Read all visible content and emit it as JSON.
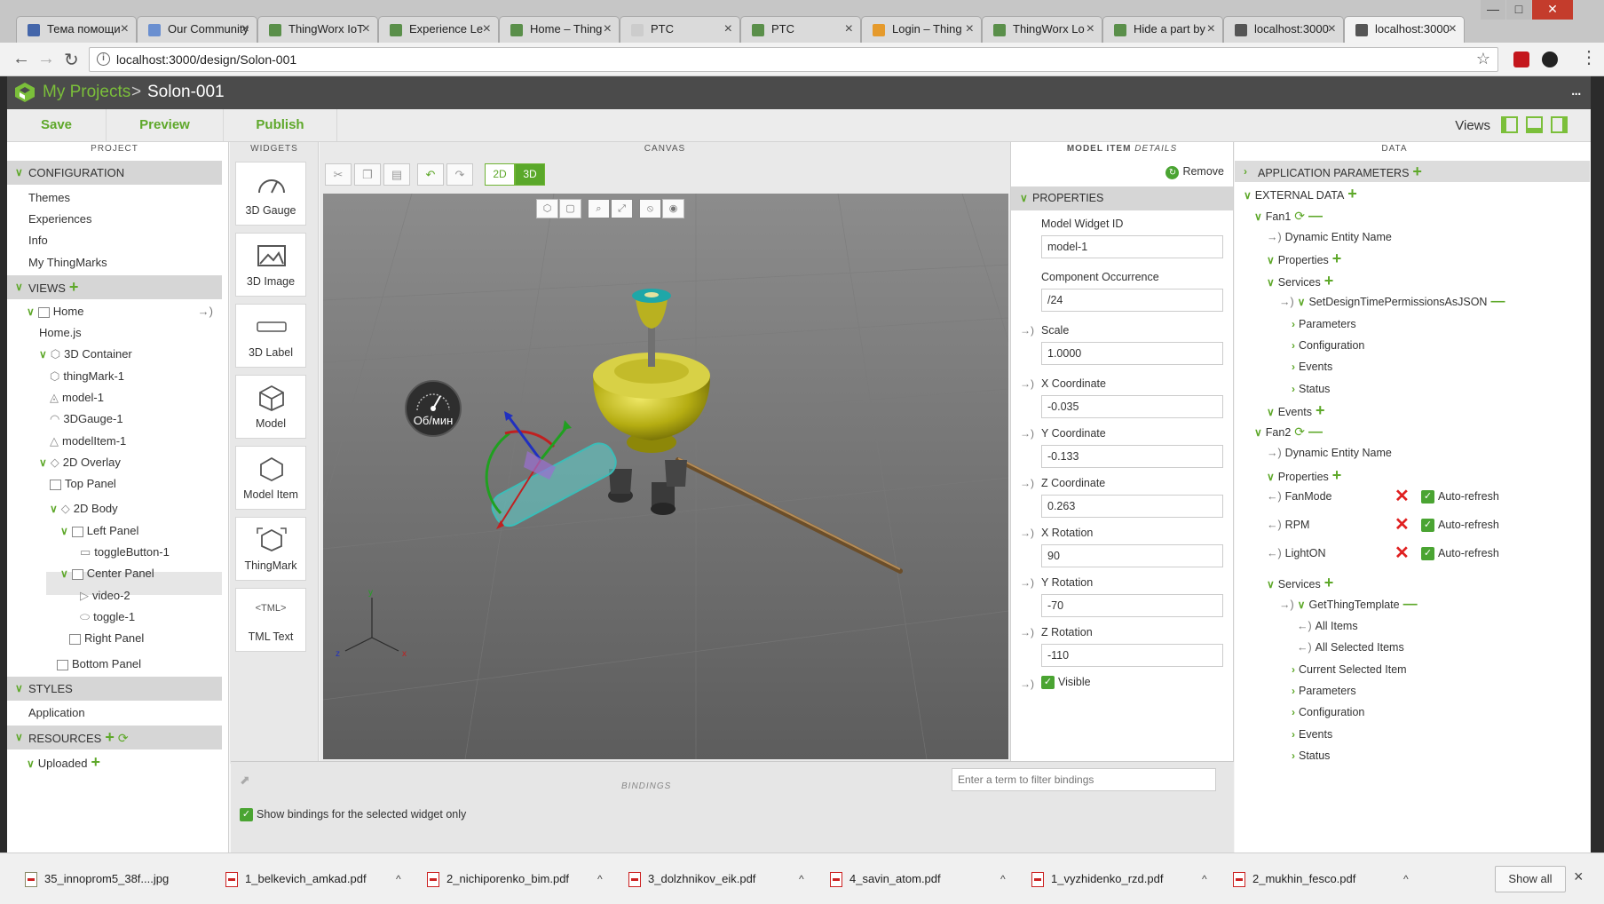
{
  "browser": {
    "tabs": [
      {
        "label": "Тема помощи",
        "fav_color": "#4466aa"
      },
      {
        "label": "Our Community",
        "fav_color": "#6a8fd0"
      },
      {
        "label": "ThingWorx IoT",
        "fav_color": "#5a8f4a"
      },
      {
        "label": "Experience Le",
        "fav_color": "#5a8f4a"
      },
      {
        "label": "Home – Thing",
        "fav_color": "#5a8f4a"
      },
      {
        "label": "PTC",
        "fav_color": "#cccccc"
      },
      {
        "label": "PTC",
        "fav_color": "#5a8f4a"
      },
      {
        "label": "Login – Thing",
        "fav_color": "#e59a2c"
      },
      {
        "label": "ThingWorx Lo",
        "fav_color": "#5a8f4a"
      },
      {
        "label": "Hide a part by",
        "fav_color": "#5a8f4a"
      },
      {
        "label": "localhost:3000",
        "fav_color": "#555555"
      },
      {
        "label": "localhost:3000",
        "fav_color": "#555555"
      }
    ],
    "tab_close": "×",
    "url": "localhost:3000/design/Solon-001",
    "info_icon": "i",
    "star_icon": "☆"
  },
  "app": {
    "breadcrumb_root": "My Projects",
    "breadcrumb_sep": ">",
    "project_name": "Solon-001",
    "more_icon": "...",
    "toolbar": {
      "save": "Save",
      "preview": "Preview",
      "publish": "Publish",
      "views": "Views"
    },
    "accent": "#6fb434"
  },
  "columns": {
    "project": "PROJECT",
    "widgets": "WIDGETS",
    "canvas": "CANVAS",
    "details_bold": "MODEL ITEM",
    "details_italic": "DETAILS",
    "data": "DATA"
  },
  "project": {
    "configuration": "CONFIGURATION",
    "config_items": [
      "Themes",
      "Experiences",
      "Info",
      "My ThingMarks"
    ],
    "views": "VIEWS",
    "home": "Home",
    "home_js": "Home.js",
    "container_3d": "3D Container",
    "container_items": [
      "thingMark-1",
      "model-1",
      "3DGauge-1",
      "modelItem-1"
    ],
    "overlay_2d": "2D Overlay",
    "top_panel": "Top Panel",
    "body_2d": "2D Body",
    "left_panel": "Left Panel",
    "toggle_button": "toggleButton-1",
    "center_panel": "Center Panel",
    "video": "video-2",
    "toggle": "toggle-1",
    "right_panel": "Right Panel",
    "bottom_panel": "Bottom Panel",
    "styles": "STYLES",
    "application": "Application",
    "resources": "RESOURCES",
    "uploaded": "Uploaded"
  },
  "widgets": [
    "3D Gauge",
    "3D Image",
    "3D Label",
    "Model",
    "Model Item",
    "ThingMark",
    "TML Text"
  ],
  "canvas": {
    "mode_2d": "2D",
    "mode_3d": "3D",
    "gauge_label": "Об/мин",
    "axis_x": "x",
    "axis_y": "y",
    "axis_z": "z"
  },
  "details": {
    "remove": "Remove",
    "properties": "PROPERTIES",
    "fields": [
      {
        "label": "Model Widget ID",
        "value": "model-1",
        "bindable": false
      },
      {
        "label": "Component Occurrence",
        "value": "/24",
        "bindable": false
      },
      {
        "label": "Scale",
        "value": "1.0000",
        "bindable": true
      },
      {
        "label": "X Coordinate",
        "value": "-0.035",
        "bindable": true
      },
      {
        "label": "Y Coordinate",
        "value": "-0.133",
        "bindable": true
      },
      {
        "label": "Z Coordinate",
        "value": "0.263",
        "bindable": true
      },
      {
        "label": "X Rotation",
        "value": "90",
        "bindable": true
      },
      {
        "label": "Y Rotation",
        "value": "-70",
        "bindable": true
      },
      {
        "label": "Z Rotation",
        "value": "-110",
        "bindable": true
      }
    ],
    "visible": "Visible"
  },
  "bindings": {
    "title": "BINDINGS",
    "filter_placeholder": "Enter a term to filter bindings",
    "selected_only": "Show bindings for the selected widget only"
  },
  "data": {
    "app_params": "APPLICATION PARAMETERS",
    "external_data": "EXTERNAL DATA",
    "fan1": "Fan1",
    "dynamic_entity_name": "Dynamic Entity Name",
    "properties": "Properties",
    "services": "Services",
    "set_perm": "SetDesignTimePermissionsAsJSON",
    "parameters": "Parameters",
    "configuration": "Configuration",
    "events": "Events",
    "status": "Status",
    "fan2": "Fan2",
    "fan2_props": [
      "FanMode",
      "RPM",
      "LightON"
    ],
    "auto_refresh": "Auto-refresh",
    "get_thing_template": "GetThingTemplate",
    "all_items": "All Items",
    "all_selected_items": "All Selected Items",
    "current_selected_item": "Current Selected Item"
  },
  "downloads": {
    "files": [
      "35_innoprom5_38f....jpg",
      "1_belkevich_amkad.pdf",
      "2_nichiporenko_bim.pdf",
      "3_dolzhnikov_eik.pdf",
      "4_savin_atom.pdf",
      "1_vyzhidenko_rzd.pdf",
      "2_mukhin_fesco.pdf"
    ],
    "show_all": "Show all",
    "close": "×",
    "caret": "^"
  }
}
